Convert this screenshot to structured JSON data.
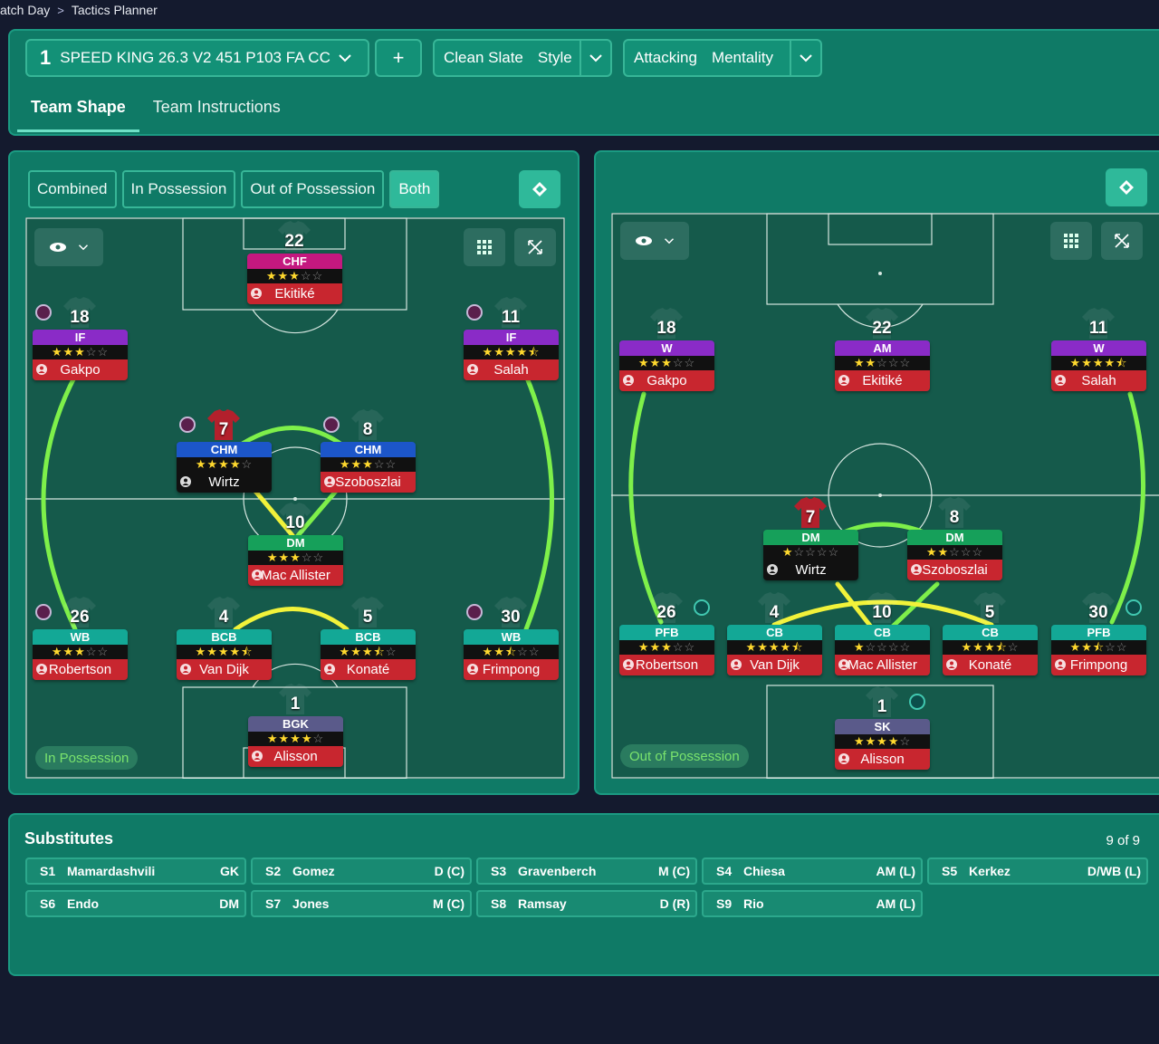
{
  "breadcrumb": {
    "part1": "atch Day",
    "part2": "Tactics Planner"
  },
  "tactic": {
    "slot": "1",
    "name": "SPEED KING 26.3 V2 451  P103 FA CC",
    "add_label": "+"
  },
  "style": {
    "a": "Clean Slate",
    "b": "Style"
  },
  "mentality": {
    "a": "Attacking",
    "b": "Mentality"
  },
  "tabs": [
    "Team Shape",
    "Team Instructions"
  ],
  "filters": [
    "Combined",
    "In Possession",
    "Out of Possession",
    "Both"
  ],
  "left_pitch": {
    "label": "In Possession",
    "players": [
      {
        "no": "22",
        "role": "CHF",
        "stars": 3,
        "name": "Ekitiké",
        "color": "#c4187f"
      },
      {
        "no": "18",
        "role": "IF",
        "stars": 3,
        "name": "Gakpo",
        "color": "#8a2bc7"
      },
      {
        "no": "11",
        "role": "IF",
        "stars": 4.5,
        "name": "Salah",
        "color": "#8a2bc7"
      },
      {
        "no": "7",
        "role": "CHM",
        "stars": 4,
        "name": "Wirtz",
        "color": "#1c56c9"
      },
      {
        "no": "8",
        "role": "CHM",
        "stars": 3,
        "name": "Szoboszlai",
        "color": "#1c56c9"
      },
      {
        "no": "10",
        "role": "DM",
        "stars": 3,
        "name": "Mac Allister",
        "color": "#16a05a"
      },
      {
        "no": "26",
        "role": "WB",
        "stars": 3,
        "name": "Robertson",
        "color": "#13a896"
      },
      {
        "no": "4",
        "role": "BCB",
        "stars": 4.5,
        "name": "Van Dijk",
        "color": "#13a896"
      },
      {
        "no": "5",
        "role": "BCB",
        "stars": 3.5,
        "name": "Konaté",
        "color": "#13a896"
      },
      {
        "no": "30",
        "role": "WB",
        "stars": 2.5,
        "name": "Frimpong",
        "color": "#13a896"
      },
      {
        "no": "1",
        "role": "BGK",
        "stars": 4,
        "name": "Alisson",
        "color": "#5a5a8a"
      }
    ]
  },
  "right_pitch": {
    "label": "Out of Possession",
    "players": [
      {
        "no": "18",
        "role": "W",
        "stars": 3,
        "name": "Gakpo",
        "color": "#8a2bc7"
      },
      {
        "no": "22",
        "role": "AM",
        "stars": 2,
        "name": "Ekitiké",
        "color": "#8a2bc7"
      },
      {
        "no": "11",
        "role": "W",
        "stars": 4.5,
        "name": "Salah",
        "color": "#8a2bc7"
      },
      {
        "no": "7",
        "role": "DM",
        "stars": 1,
        "name": "Wirtz",
        "color": "#16a05a"
      },
      {
        "no": "8",
        "role": "DM",
        "stars": 2,
        "name": "Szoboszlai",
        "color": "#16a05a"
      },
      {
        "no": "26",
        "role": "PFB",
        "stars": 3,
        "name": "Robertson",
        "color": "#13a896"
      },
      {
        "no": "4",
        "role": "CB",
        "stars": 4.5,
        "name": "Van Dijk",
        "color": "#13a896"
      },
      {
        "no": "10",
        "role": "CB",
        "stars": 1,
        "name": "Mac Allister",
        "color": "#13a896"
      },
      {
        "no": "5",
        "role": "CB",
        "stars": 3.5,
        "name": "Konaté",
        "color": "#13a896"
      },
      {
        "no": "30",
        "role": "PFB",
        "stars": 2.5,
        "name": "Frimpong",
        "color": "#13a896"
      },
      {
        "no": "1",
        "role": "SK",
        "stars": 4,
        "name": "Alisson",
        "color": "#5a5a8a"
      }
    ]
  },
  "subs": {
    "title": "Substitutes",
    "count": "9 of 9",
    "items": [
      {
        "slot": "S1",
        "name": "Mamardashvili",
        "pos": "GK"
      },
      {
        "slot": "S2",
        "name": "Gomez",
        "pos": "D (C)"
      },
      {
        "slot": "S3",
        "name": "Gravenberch",
        "pos": "M (C)"
      },
      {
        "slot": "S4",
        "name": "Chiesa",
        "pos": "AM (L)"
      },
      {
        "slot": "S5",
        "name": "Kerkez",
        "pos": "D/WB (L)"
      },
      {
        "slot": "S6",
        "name": "Endo",
        "pos": "DM"
      },
      {
        "slot": "S7",
        "name": "Jones",
        "pos": "M (C)"
      },
      {
        "slot": "S8",
        "name": "Ramsay",
        "pos": "D (R)"
      },
      {
        "slot": "S9",
        "name": "Rio",
        "pos": "AM (L)"
      }
    ]
  },
  "icons": [
    "chevron-down-icon",
    "eye-icon",
    "grid-icon",
    "expand-icon",
    "diamond-icon",
    "person-icon",
    "shirt-icon"
  ]
}
